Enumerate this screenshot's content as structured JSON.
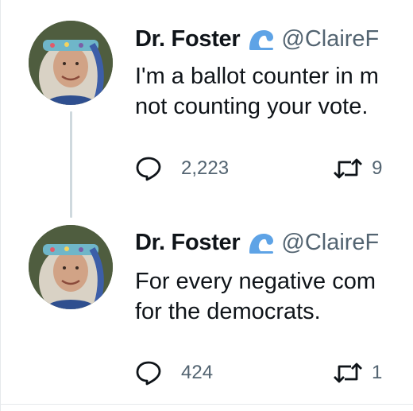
{
  "tweets": [
    {
      "display_name": "Dr. Foster",
      "handle": "@ClaireF",
      "text_line1": "I'm a ballot counter in m",
      "text_line2": "not counting your vote.",
      "reply_count": "2,223",
      "retweet_count": "9"
    },
    {
      "display_name": "Dr. Foster",
      "handle": "@ClaireF",
      "text_line1": "For every negative com",
      "text_line2": "for the democrats.",
      "reply_count": "424",
      "retweet_count": "1"
    }
  ],
  "icons": {
    "verified_badge": "wave-icon",
    "reply": "speech-bubble-icon",
    "retweet": "retweet-arrows-icon"
  },
  "colors": {
    "text": "#0f1419",
    "secondary": "#536471",
    "wave": "#5ea3e6",
    "thread_line": "#cfd9de"
  }
}
